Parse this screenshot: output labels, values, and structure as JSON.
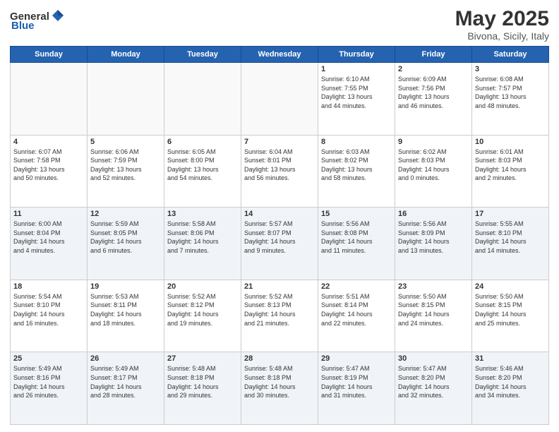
{
  "header": {
    "logo_general": "General",
    "logo_blue": "Blue",
    "month": "May 2025",
    "location": "Bivona, Sicily, Italy"
  },
  "days_of_week": [
    "Sunday",
    "Monday",
    "Tuesday",
    "Wednesday",
    "Thursday",
    "Friday",
    "Saturday"
  ],
  "weeks": [
    [
      {
        "day": "",
        "text": "",
        "empty": true
      },
      {
        "day": "",
        "text": "",
        "empty": true
      },
      {
        "day": "",
        "text": "",
        "empty": true
      },
      {
        "day": "",
        "text": "",
        "empty": true
      },
      {
        "day": "1",
        "text": "Sunrise: 6:10 AM\nSunset: 7:55 PM\nDaylight: 13 hours\nand 44 minutes."
      },
      {
        "day": "2",
        "text": "Sunrise: 6:09 AM\nSunset: 7:56 PM\nDaylight: 13 hours\nand 46 minutes."
      },
      {
        "day": "3",
        "text": "Sunrise: 6:08 AM\nSunset: 7:57 PM\nDaylight: 13 hours\nand 48 minutes."
      }
    ],
    [
      {
        "day": "4",
        "text": "Sunrise: 6:07 AM\nSunset: 7:58 PM\nDaylight: 13 hours\nand 50 minutes."
      },
      {
        "day": "5",
        "text": "Sunrise: 6:06 AM\nSunset: 7:59 PM\nDaylight: 13 hours\nand 52 minutes."
      },
      {
        "day": "6",
        "text": "Sunrise: 6:05 AM\nSunset: 8:00 PM\nDaylight: 13 hours\nand 54 minutes."
      },
      {
        "day": "7",
        "text": "Sunrise: 6:04 AM\nSunset: 8:01 PM\nDaylight: 13 hours\nand 56 minutes."
      },
      {
        "day": "8",
        "text": "Sunrise: 6:03 AM\nSunset: 8:02 PM\nDaylight: 13 hours\nand 58 minutes."
      },
      {
        "day": "9",
        "text": "Sunrise: 6:02 AM\nSunset: 8:03 PM\nDaylight: 14 hours\nand 0 minutes."
      },
      {
        "day": "10",
        "text": "Sunrise: 6:01 AM\nSunset: 8:03 PM\nDaylight: 14 hours\nand 2 minutes."
      }
    ],
    [
      {
        "day": "11",
        "text": "Sunrise: 6:00 AM\nSunset: 8:04 PM\nDaylight: 14 hours\nand 4 minutes."
      },
      {
        "day": "12",
        "text": "Sunrise: 5:59 AM\nSunset: 8:05 PM\nDaylight: 14 hours\nand 6 minutes."
      },
      {
        "day": "13",
        "text": "Sunrise: 5:58 AM\nSunset: 8:06 PM\nDaylight: 14 hours\nand 7 minutes."
      },
      {
        "day": "14",
        "text": "Sunrise: 5:57 AM\nSunset: 8:07 PM\nDaylight: 14 hours\nand 9 minutes."
      },
      {
        "day": "15",
        "text": "Sunrise: 5:56 AM\nSunset: 8:08 PM\nDaylight: 14 hours\nand 11 minutes."
      },
      {
        "day": "16",
        "text": "Sunrise: 5:56 AM\nSunset: 8:09 PM\nDaylight: 14 hours\nand 13 minutes."
      },
      {
        "day": "17",
        "text": "Sunrise: 5:55 AM\nSunset: 8:10 PM\nDaylight: 14 hours\nand 14 minutes."
      }
    ],
    [
      {
        "day": "18",
        "text": "Sunrise: 5:54 AM\nSunset: 8:10 PM\nDaylight: 14 hours\nand 16 minutes."
      },
      {
        "day": "19",
        "text": "Sunrise: 5:53 AM\nSunset: 8:11 PM\nDaylight: 14 hours\nand 18 minutes."
      },
      {
        "day": "20",
        "text": "Sunrise: 5:52 AM\nSunset: 8:12 PM\nDaylight: 14 hours\nand 19 minutes."
      },
      {
        "day": "21",
        "text": "Sunrise: 5:52 AM\nSunset: 8:13 PM\nDaylight: 14 hours\nand 21 minutes."
      },
      {
        "day": "22",
        "text": "Sunrise: 5:51 AM\nSunset: 8:14 PM\nDaylight: 14 hours\nand 22 minutes."
      },
      {
        "day": "23",
        "text": "Sunrise: 5:50 AM\nSunset: 8:15 PM\nDaylight: 14 hours\nand 24 minutes."
      },
      {
        "day": "24",
        "text": "Sunrise: 5:50 AM\nSunset: 8:15 PM\nDaylight: 14 hours\nand 25 minutes."
      }
    ],
    [
      {
        "day": "25",
        "text": "Sunrise: 5:49 AM\nSunset: 8:16 PM\nDaylight: 14 hours\nand 26 minutes."
      },
      {
        "day": "26",
        "text": "Sunrise: 5:49 AM\nSunset: 8:17 PM\nDaylight: 14 hours\nand 28 minutes."
      },
      {
        "day": "27",
        "text": "Sunrise: 5:48 AM\nSunset: 8:18 PM\nDaylight: 14 hours\nand 29 minutes."
      },
      {
        "day": "28",
        "text": "Sunrise: 5:48 AM\nSunset: 8:18 PM\nDaylight: 14 hours\nand 30 minutes."
      },
      {
        "day": "29",
        "text": "Sunrise: 5:47 AM\nSunset: 8:19 PM\nDaylight: 14 hours\nand 31 minutes."
      },
      {
        "day": "30",
        "text": "Sunrise: 5:47 AM\nSunset: 8:20 PM\nDaylight: 14 hours\nand 32 minutes."
      },
      {
        "day": "31",
        "text": "Sunrise: 5:46 AM\nSunset: 8:20 PM\nDaylight: 14 hours\nand 34 minutes."
      }
    ]
  ]
}
